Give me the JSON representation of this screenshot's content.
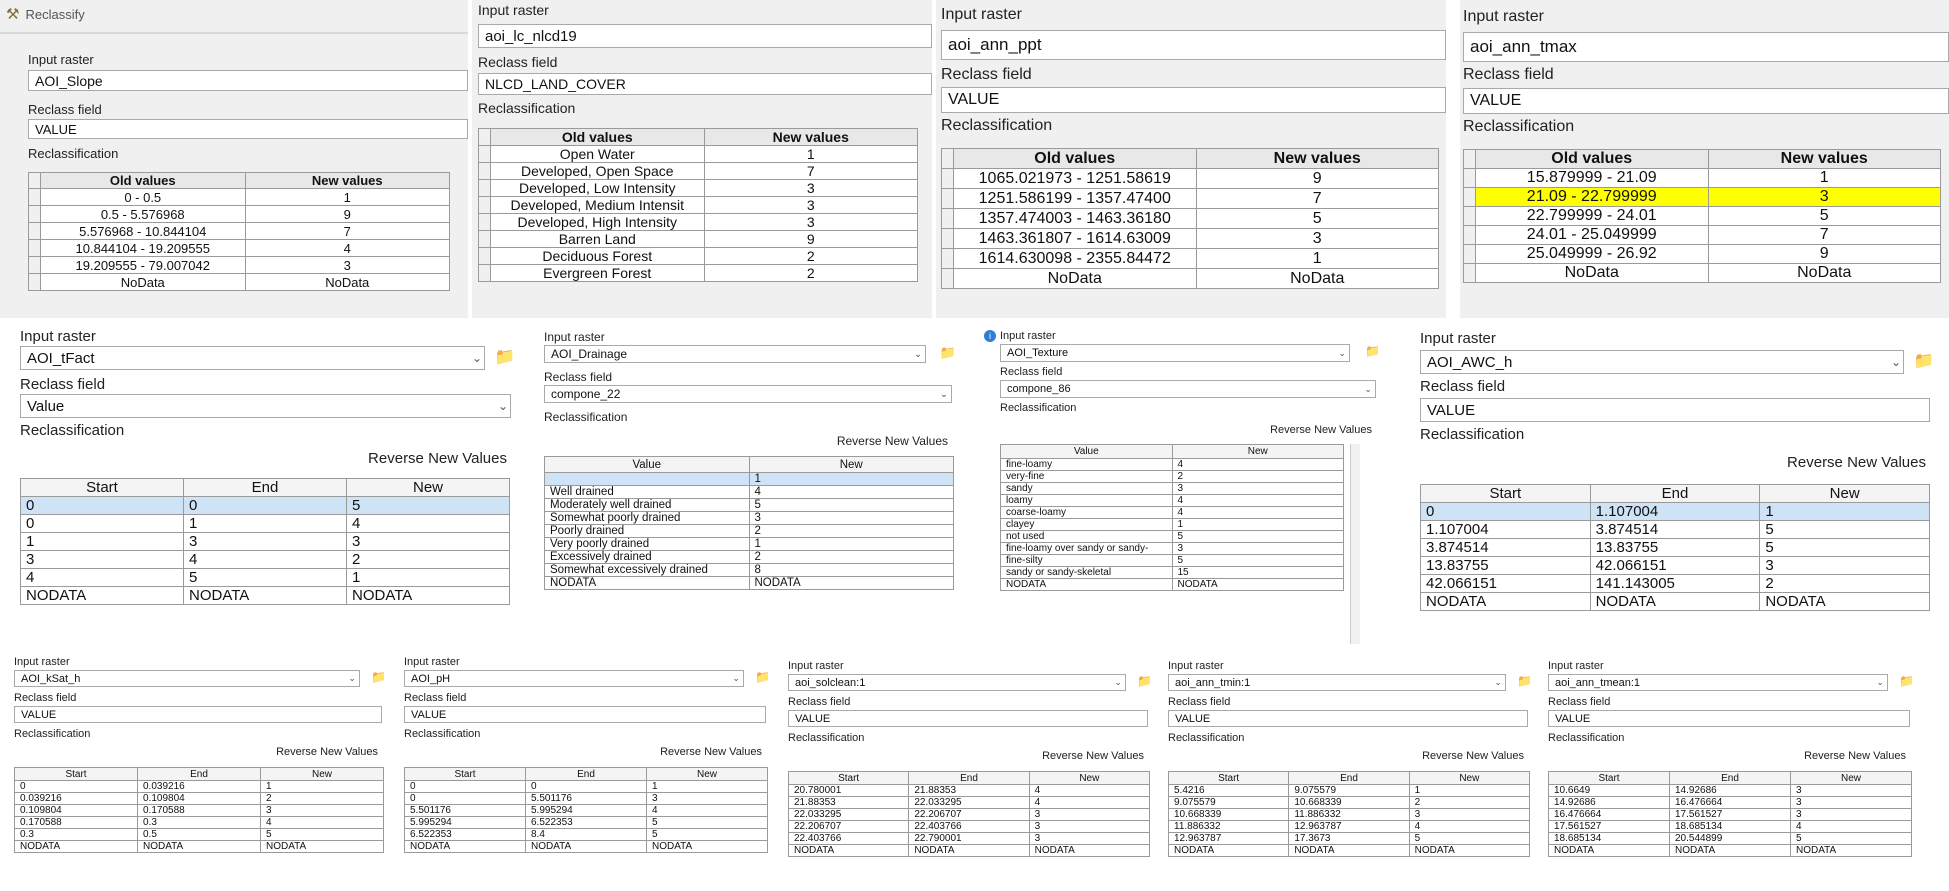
{
  "reclassify_title": "Reclassify",
  "p1": {
    "input_label": "Input raster",
    "input_value": "AOI_Slope",
    "field_label": "Reclass field",
    "field_value": "VALUE",
    "recl_label": "Reclassification",
    "headers": [
      "Old values",
      "New values"
    ],
    "rows": [
      [
        "0 - 0.5",
        "1"
      ],
      [
        "0.5 - 5.576968",
        "9"
      ],
      [
        "5.576968 - 10.844104",
        "7"
      ],
      [
        "10.844104 - 19.209555",
        "4"
      ],
      [
        "19.209555 - 79.007042",
        "3"
      ],
      [
        "NoData",
        "NoData"
      ]
    ]
  },
  "p2": {
    "input_label": "Input raster",
    "input_value": "aoi_lc_nlcd19",
    "field_label": "Reclass field",
    "field_value": "NLCD_LAND_COVER",
    "recl_label": "Reclassification",
    "headers": [
      "Old values",
      "New values"
    ],
    "rows": [
      [
        "Open Water",
        "1"
      ],
      [
        "Developed, Open Space",
        "7"
      ],
      [
        "Developed, Low Intensity",
        "3"
      ],
      [
        "Developed, Medium Intensit",
        "3"
      ],
      [
        "Developed, High Intensity",
        "3"
      ],
      [
        "Barren Land",
        "9"
      ],
      [
        "Deciduous Forest",
        "2"
      ],
      [
        "Evergreen Forest",
        "2"
      ]
    ]
  },
  "p3": {
    "input_label": "Input raster",
    "input_value": "aoi_ann_ppt",
    "field_label": "Reclass field",
    "field_value": "VALUE",
    "recl_label": "Reclassification",
    "headers": [
      "Old values",
      "New values"
    ],
    "rows": [
      [
        "1065.021973 - 1251.58619",
        "9"
      ],
      [
        "1251.586199 - 1357.47400",
        "7"
      ],
      [
        "1357.474003 - 1463.36180",
        "5"
      ],
      [
        "1463.361807 - 1614.63009",
        "3"
      ],
      [
        "1614.630098 - 2355.84472",
        "1"
      ],
      [
        "NoData",
        "NoData"
      ]
    ]
  },
  "p4": {
    "input_label": "Input raster",
    "input_value": "aoi_ann_tmax",
    "field_label": "Reclass field",
    "field_value": "VALUE",
    "recl_label": "Reclassification",
    "headers": [
      "Old values",
      "New values"
    ],
    "rows": [
      [
        "15.879999 - 21.09",
        "1"
      ],
      [
        "21.09 - 22.799999",
        "3"
      ],
      [
        "22.799999 - 24.01",
        "5"
      ],
      [
        "24.01 - 25.049999",
        "7"
      ],
      [
        "25.049999 - 26.92",
        "9"
      ],
      [
        "NoData",
        "NoData"
      ]
    ]
  },
  "p5": {
    "input_label": "Input raster",
    "input_value": "AOI_tFact",
    "field_label": "Reclass field",
    "field_value": "Value",
    "recl_label": "Reclassification",
    "reverse": "Reverse New Values",
    "headers": [
      "Start",
      "End",
      "New"
    ],
    "rows": [
      [
        "0",
        "0",
        "5"
      ],
      [
        "0",
        "1",
        "4"
      ],
      [
        "1",
        "3",
        "3"
      ],
      [
        "3",
        "4",
        "2"
      ],
      [
        "4",
        "5",
        "1"
      ],
      [
        "NODATA",
        "NODATA",
        "NODATA"
      ]
    ]
  },
  "p6": {
    "input_label": "Input raster",
    "input_value": "AOI_Drainage",
    "field_label": "Reclass field",
    "field_value": "compone_22",
    "recl_label": "Reclassification",
    "reverse": "Reverse New Values",
    "headers": [
      "Value",
      "New"
    ],
    "rows": [
      [
        "",
        "1"
      ],
      [
        "Well drained",
        "4"
      ],
      [
        "Moderately well drained",
        "5"
      ],
      [
        "Somewhat poorly drained",
        "3"
      ],
      [
        "Poorly drained",
        "2"
      ],
      [
        "Very poorly drained",
        "1"
      ],
      [
        "Excessively drained",
        "2"
      ],
      [
        "Somewhat excessively drained",
        "8"
      ],
      [
        "NODATA",
        "NODATA"
      ]
    ]
  },
  "p7": {
    "input_label": "Input raster",
    "input_value": "AOI_Texture",
    "field_label": "Reclass field",
    "field_value": "compone_86",
    "recl_label": "Reclassification",
    "reverse": "Reverse New Values",
    "headers": [
      "Value",
      "New"
    ],
    "rows": [
      [
        "fine-loamy",
        "4"
      ],
      [
        "very-fine",
        "2"
      ],
      [
        "sandy",
        "3"
      ],
      [
        "loamy",
        "4"
      ],
      [
        "coarse-loamy",
        "4"
      ],
      [
        "clayey",
        "1"
      ],
      [
        "not used",
        "5"
      ],
      [
        "fine-loamy over sandy or sandy-",
        "3"
      ],
      [
        "fine-silty",
        "5"
      ],
      [
        "sandy or sandy-skeletal",
        "15"
      ],
      [
        "NODATA",
        "NODATA"
      ]
    ]
  },
  "p8": {
    "input_label": "Input raster",
    "input_value": "AOI_AWC_h",
    "field_label": "Reclass field",
    "field_value": "VALUE",
    "recl_label": "Reclassification",
    "reverse": "Reverse New Values",
    "headers": [
      "Start",
      "End",
      "New"
    ],
    "rows": [
      [
        "0",
        "1.107004",
        "1"
      ],
      [
        "1.107004",
        "3.874514",
        "5"
      ],
      [
        "3.874514",
        "13.83755",
        "5"
      ],
      [
        "13.83755",
        "42.066151",
        "3"
      ],
      [
        "42.066151",
        "141.143005",
        "2"
      ],
      [
        "NODATA",
        "NODATA",
        "NODATA"
      ]
    ]
  },
  "p9": {
    "input_label": "Input raster",
    "input_value": "AOI_kSat_h",
    "field_label": "Reclass field",
    "field_value": "VALUE",
    "recl_label": "Reclassification",
    "reverse": "Reverse New Values",
    "headers": [
      "Start",
      "End",
      "New"
    ],
    "rows": [
      [
        "0",
        "0.039216",
        "1"
      ],
      [
        "0.039216",
        "0.109804",
        "2"
      ],
      [
        "0.109804",
        "0.170588",
        "3"
      ],
      [
        "0.170588",
        "0.3",
        "4"
      ],
      [
        "0.3",
        "0.5",
        "5"
      ],
      [
        "NODATA",
        "NODATA",
        "NODATA"
      ]
    ]
  },
  "p10": {
    "input_label": "Input raster",
    "input_value": "AOI_pH",
    "field_label": "Reclass field",
    "field_value": "VALUE",
    "recl_label": "Reclassification",
    "reverse": "Reverse New Values",
    "headers": [
      "Start",
      "End",
      "New"
    ],
    "rows": [
      [
        "0",
        "0",
        "1"
      ],
      [
        "0",
        "5.501176",
        "3"
      ],
      [
        "5.501176",
        "5.995294",
        "4"
      ],
      [
        "5.995294",
        "6.522353",
        "5"
      ],
      [
        "6.522353",
        "8.4",
        "5"
      ],
      [
        "NODATA",
        "NODATA",
        "NODATA"
      ]
    ]
  },
  "p11": {
    "input_label": "Input raster",
    "input_value": "aoi_solclean:1",
    "field_label": "Reclass field",
    "field_value": "VALUE",
    "recl_label": "Reclassification",
    "reverse": "Reverse New Values",
    "headers": [
      "Start",
      "End",
      "New"
    ],
    "rows": [
      [
        "20.780001",
        "21.88353",
        "4"
      ],
      [
        "21.88353",
        "22.033295",
        "4"
      ],
      [
        "22.033295",
        "22.206707",
        "3"
      ],
      [
        "22.206707",
        "22.403766",
        "3"
      ],
      [
        "22.403766",
        "22.790001",
        "3"
      ],
      [
        "NODATA",
        "NODATA",
        "NODATA"
      ]
    ]
  },
  "p12": {
    "input_label": "Input raster",
    "input_value": "aoi_ann_tmin:1",
    "field_label": "Reclass field",
    "field_value": "VALUE",
    "recl_label": "Reclassification",
    "reverse": "Reverse New Values",
    "headers": [
      "Start",
      "End",
      "New"
    ],
    "rows": [
      [
        "5.4216",
        "9.075579",
        "1"
      ],
      [
        "9.075579",
        "10.668339",
        "2"
      ],
      [
        "10.668339",
        "11.886332",
        "3"
      ],
      [
        "11.886332",
        "12.963787",
        "4"
      ],
      [
        "12.963787",
        "17.3673",
        "5"
      ],
      [
        "NODATA",
        "NODATA",
        "NODATA"
      ]
    ]
  },
  "p13": {
    "input_label": "Input raster",
    "input_value": "aoi_ann_tmean:1",
    "field_label": "Reclass field",
    "field_value": "VALUE",
    "recl_label": "Reclassification",
    "reverse": "Reverse New Values",
    "headers": [
      "Start",
      "End",
      "New"
    ],
    "rows": [
      [
        "10.6649",
        "14.92686",
        "3"
      ],
      [
        "14.92686",
        "16.476664",
        "3"
      ],
      [
        "16.476664",
        "17.561527",
        "3"
      ],
      [
        "17.561527",
        "18.685134",
        "4"
      ],
      [
        "18.685134",
        "20.544899",
        "5"
      ],
      [
        "NODATA",
        "NODATA",
        "NODATA"
      ]
    ]
  },
  "colors": {
    "highlight": "#ffff00",
    "selected": "#cfe3f7",
    "folder": "#e0a526"
  },
  "icons": [
    "hammer-icon",
    "chevron-down-icon",
    "folder-icon",
    "info-icon"
  ]
}
